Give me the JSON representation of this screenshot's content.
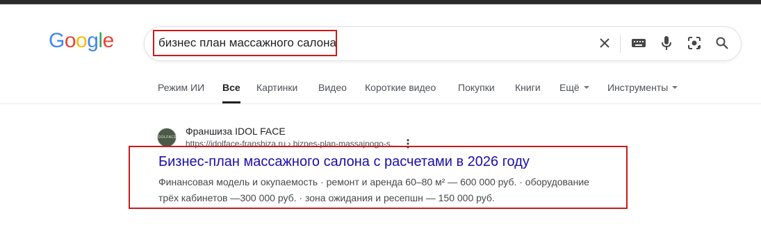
{
  "logo": {
    "letters": [
      "G",
      "o",
      "o",
      "g",
      "l",
      "e"
    ],
    "colors": [
      "#4285F4",
      "#EA4335",
      "#FBBC05",
      "#4285F4",
      "#34A853",
      "#EA4335"
    ]
  },
  "search": {
    "query": "бизнес план массажного салона",
    "icons": [
      "close-icon",
      "keyboard-icon",
      "microphone-icon",
      "lens-icon",
      "search-icon"
    ]
  },
  "tabs": [
    {
      "label": "Режим ИИ",
      "active": false
    },
    {
      "label": "Все",
      "active": true
    },
    {
      "label": "Картинки",
      "active": false
    },
    {
      "label": "Видео",
      "active": false
    },
    {
      "label": "Короткие видео",
      "active": false
    },
    {
      "label": "Покупки",
      "active": false
    },
    {
      "label": "Книги",
      "active": false
    },
    {
      "label": "Ещё",
      "active": false,
      "dropdown": true
    },
    {
      "label": "Инструменты",
      "active": false,
      "dropdown": true
    }
  ],
  "result": {
    "site_name": "Франшиза IDOL FACE",
    "url": "https://idolface-franshiza.ru › biznes-plan-massajnogo-s...",
    "favicon_text": "IDOLFACE",
    "title": "Бизнес-план массажного салона с расчетами в 2026 году",
    "snippet_line1": "Финансовая модель и окупаемость · ремонт и аренда 60–80 м² — 600 000 руб. · оборудование",
    "snippet_line2": "трёх кабинетов —300 000 руб. · зона ожидания и ресепшн — 150 000 руб."
  },
  "colors": {
    "highlight_frame": "#cc1818",
    "link": "#1a0dab"
  }
}
